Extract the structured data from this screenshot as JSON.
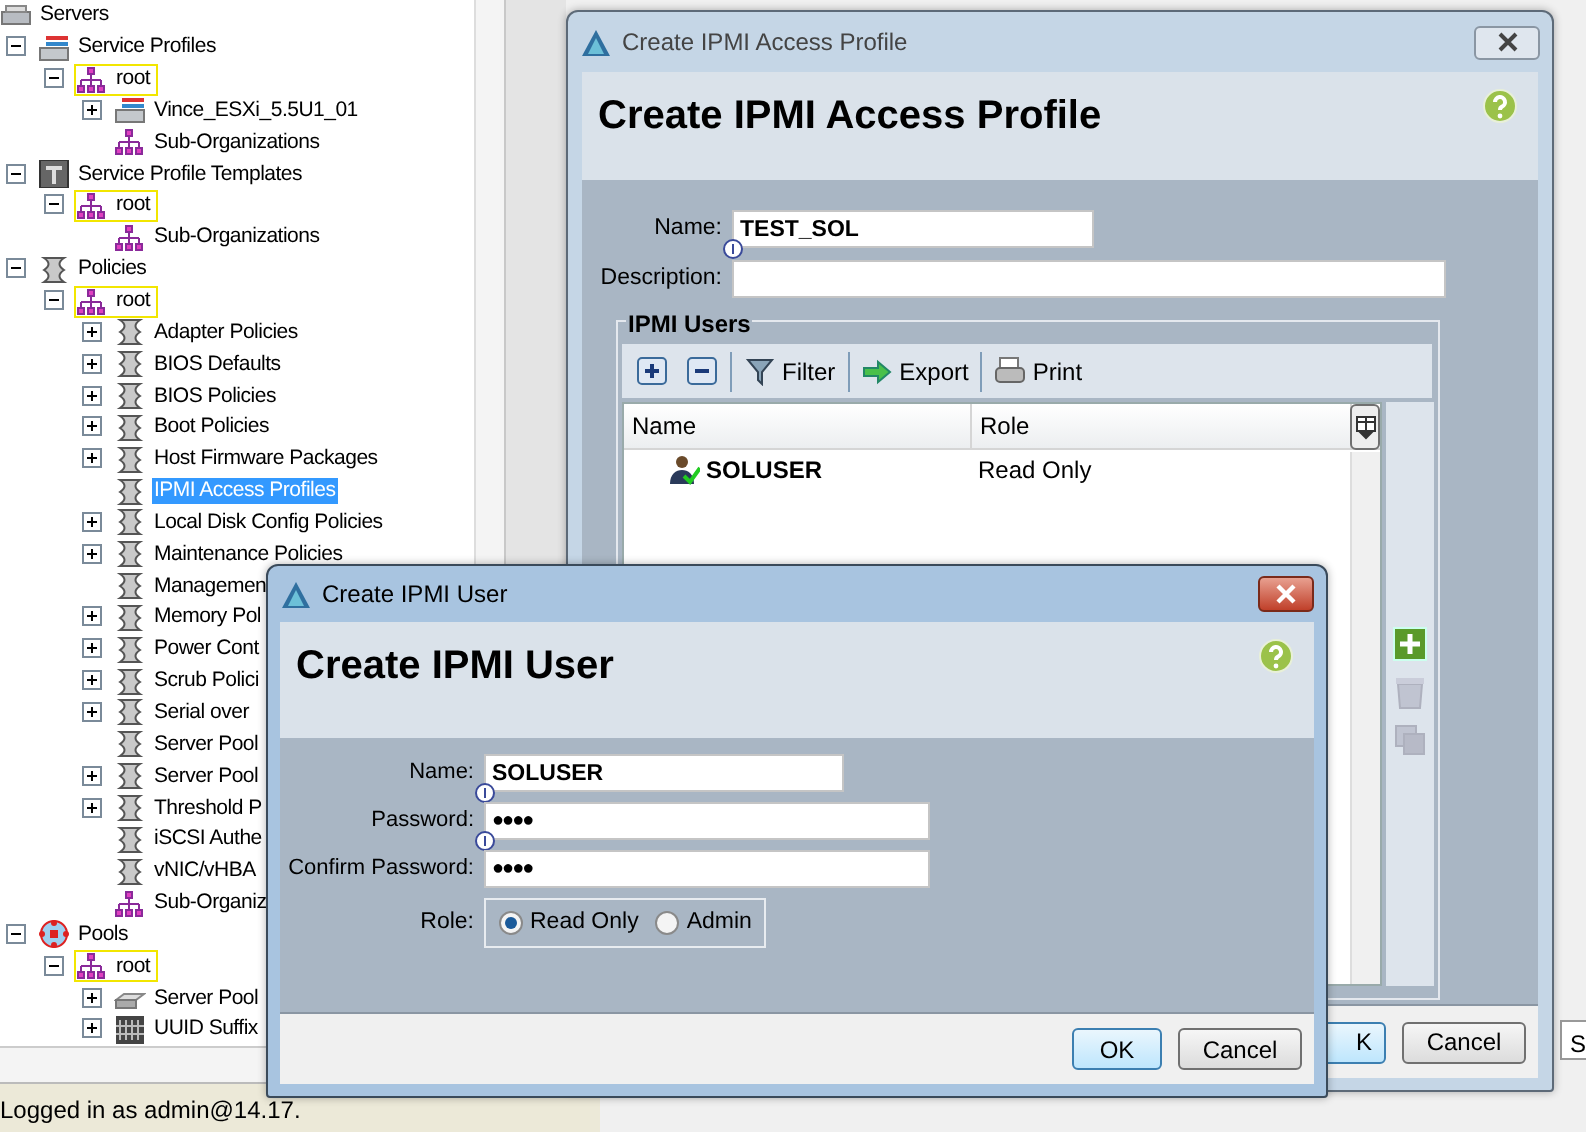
{
  "tree": {
    "items": [
      {
        "label": "Servers",
        "kind": "server",
        "selected": false,
        "outlined": false,
        "children": [
          {
            "label": "Service Profiles",
            "kind": "profiles",
            "expanded": true,
            "selected": false,
            "outlined": false,
            "children": [
              {
                "label": "root",
                "kind": "org",
                "expanded": true,
                "selected": false,
                "outlined": true,
                "children": [
                  {
                    "label": "Vince_ESXi_5.5U1_01",
                    "kind": "profiles",
                    "expanded": false,
                    "selected": false,
                    "outlined": false
                  },
                  {
                    "label": "Sub-Organizations",
                    "kind": "org",
                    "selected": false,
                    "outlined": false
                  }
                ]
              }
            ]
          },
          {
            "label": "Service Profile Templates",
            "kind": "template",
            "expanded": true,
            "selected": false,
            "outlined": false,
            "children": [
              {
                "label": "root",
                "kind": "org",
                "expanded": true,
                "selected": false,
                "outlined": true,
                "children": [
                  {
                    "label": "Sub-Organizations",
                    "kind": "org",
                    "selected": false,
                    "outlined": false
                  }
                ]
              }
            ]
          },
          {
            "label": "Policies",
            "kind": "policy",
            "expanded": true,
            "selected": false,
            "outlined": false,
            "children": [
              {
                "label": "root",
                "kind": "org",
                "expanded": true,
                "selected": false,
                "outlined": true,
                "children": [
                  {
                    "label": "Adapter Policies",
                    "kind": "policy",
                    "expanded": false,
                    "selected": false,
                    "outlined": false
                  },
                  {
                    "label": "BIOS Defaults",
                    "kind": "policy",
                    "expanded": false,
                    "selected": false,
                    "outlined": false
                  },
                  {
                    "label": "BIOS Policies",
                    "kind": "policy",
                    "expanded": false,
                    "selected": false,
                    "outlined": false
                  },
                  {
                    "label": "Boot Policies",
                    "kind": "policy",
                    "expanded": false,
                    "selected": false,
                    "outlined": false
                  },
                  {
                    "label": "Host Firmware Packages",
                    "kind": "policy",
                    "expanded": false,
                    "selected": false,
                    "outlined": false
                  },
                  {
                    "label": "IPMI Access Profiles",
                    "kind": "policy",
                    "selected": true,
                    "outlined": false
                  },
                  {
                    "label": "Local Disk Config Policies",
                    "kind": "policy",
                    "expanded": false,
                    "selected": false,
                    "outlined": false
                  },
                  {
                    "label": "Maintenance Policies",
                    "kind": "policy",
                    "expanded": false,
                    "selected": false,
                    "outlined": false
                  },
                  {
                    "label": "Managemen",
                    "kind": "policy",
                    "selected": false,
                    "outlined": false
                  },
                  {
                    "label": "Memory Pol",
                    "kind": "policy",
                    "expanded": false,
                    "selected": false,
                    "outlined": false
                  },
                  {
                    "label": "Power Cont",
                    "kind": "policy",
                    "expanded": false,
                    "selected": false,
                    "outlined": false
                  },
                  {
                    "label": "Scrub Polici",
                    "kind": "policy",
                    "expanded": false,
                    "selected": false,
                    "outlined": false
                  },
                  {
                    "label": "Serial over",
                    "kind": "policy",
                    "expanded": false,
                    "selected": false,
                    "outlined": false
                  },
                  {
                    "label": "Server Pool",
                    "kind": "policy",
                    "selected": false,
                    "outlined": false
                  },
                  {
                    "label": "Server Pool",
                    "kind": "policy",
                    "expanded": false,
                    "selected": false,
                    "outlined": false
                  },
                  {
                    "label": "Threshold P",
                    "kind": "policy",
                    "expanded": false,
                    "selected": false,
                    "outlined": false
                  },
                  {
                    "label": "iSCSI Authe",
                    "kind": "policy",
                    "selected": false,
                    "outlined": false
                  },
                  {
                    "label": "vNIC/vHBA",
                    "kind": "policy",
                    "selected": false,
                    "outlined": false
                  },
                  {
                    "label": "Sub-Organiz",
                    "kind": "org",
                    "selected": false,
                    "outlined": false
                  }
                ]
              }
            ]
          },
          {
            "label": "Pools",
            "kind": "pools",
            "expanded": true,
            "selected": false,
            "outlined": false,
            "children": [
              {
                "label": "root",
                "kind": "org",
                "expanded": true,
                "selected": false,
                "outlined": true,
                "children": [
                  {
                    "label": "Server Pool",
                    "kind": "pool",
                    "expanded": false,
                    "selected": false,
                    "outlined": false
                  },
                  {
                    "label": "UUID Suffix",
                    "kind": "uuid",
                    "expanded": false,
                    "selected": false,
                    "outlined": false
                  }
                ]
              }
            ]
          }
        ]
      }
    ]
  },
  "status_bar": {
    "text": "Logged in as admin@14.17."
  },
  "edge_tab": {
    "label": "S"
  },
  "profile_window": {
    "title": "Create IPMI Access Profile",
    "heading": "Create IPMI Access Profile",
    "fields": [
      {
        "label": "Name:",
        "value": "TEST_SOL",
        "required": true
      },
      {
        "label": "Description:",
        "required": false
      }
    ],
    "users": {
      "title": "IPMI Users",
      "toolbar": [
        {
          "kind": "add"
        },
        {
          "kind": "remove"
        },
        {
          "kind": "filter",
          "label": "Filter"
        },
        {
          "kind": "export",
          "label": "Export"
        },
        {
          "kind": "print",
          "label": "Print"
        }
      ],
      "columns": [
        "Name",
        "Role"
      ],
      "rows": [
        {
          "name": "SOLUSER",
          "role": "Read Only"
        }
      ]
    },
    "side_buttons": [
      {
        "kind": "add",
        "disabled": false
      },
      {
        "kind": "delete",
        "disabled": true
      },
      {
        "kind": "copy",
        "disabled": true
      }
    ],
    "buttons": [
      {
        "label": "K",
        "default": true
      },
      {
        "label": "Cancel",
        "default": false
      }
    ]
  },
  "user_dialog": {
    "title": "Create IPMI User",
    "heading": "Create IPMI User",
    "fields": [
      {
        "label": "Name:",
        "value": "SOLUSER",
        "kind": "text",
        "required": true
      },
      {
        "label": "Password:",
        "value": "●●●●",
        "kind": "password",
        "required": true
      },
      {
        "label": "Confirm Password:",
        "value": "●●●●",
        "kind": "password",
        "required": false
      }
    ],
    "role": {
      "label": "Role:",
      "options": [
        {
          "label": "Read Only",
          "selected": true
        },
        {
          "label": "Admin",
          "selected": false
        }
      ]
    },
    "buttons": [
      {
        "label": "OK",
        "default": true
      },
      {
        "label": "Cancel",
        "default": false
      }
    ]
  }
}
